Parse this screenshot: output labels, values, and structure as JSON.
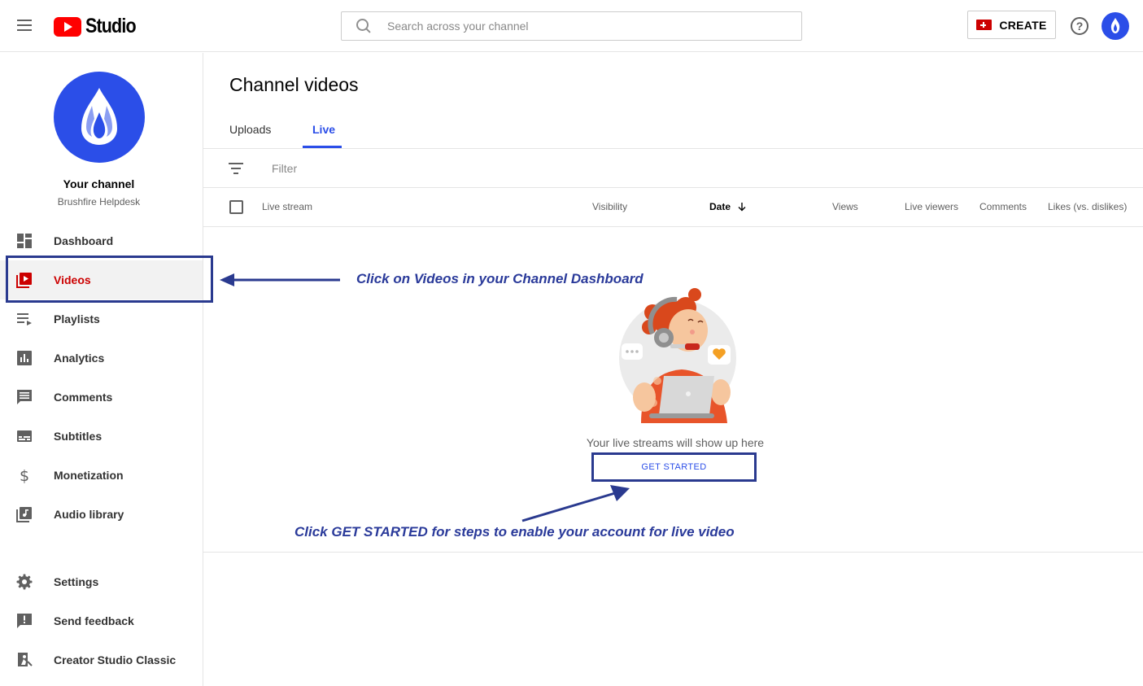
{
  "header": {
    "app_name": "Studio",
    "search_placeholder": "Search across your channel",
    "create_label": "CREATE",
    "help_symbol": "?"
  },
  "sidebar": {
    "channel_title": "Your channel",
    "channel_name": "Brushfire Helpdesk",
    "items": [
      {
        "label": "Dashboard",
        "icon": "dashboard-icon"
      },
      {
        "label": "Videos",
        "icon": "videos-icon",
        "active": true
      },
      {
        "label": "Playlists",
        "icon": "playlists-icon"
      },
      {
        "label": "Analytics",
        "icon": "analytics-icon"
      },
      {
        "label": "Comments",
        "icon": "comments-icon"
      },
      {
        "label": "Subtitles",
        "icon": "subtitles-icon"
      },
      {
        "label": "Monetization",
        "icon": "dollar-icon"
      },
      {
        "label": "Audio library",
        "icon": "audio-library-icon"
      }
    ],
    "footer_items": [
      {
        "label": "Settings",
        "icon": "gear-icon"
      },
      {
        "label": "Send feedback",
        "icon": "feedback-icon"
      },
      {
        "label": "Creator Studio Classic",
        "icon": "classic-studio-icon"
      }
    ]
  },
  "main": {
    "title": "Channel videos",
    "tabs": [
      {
        "label": "Uploads",
        "active": false
      },
      {
        "label": "Live",
        "active": true
      }
    ],
    "filter_placeholder": "Filter",
    "columns": {
      "stream": "Live stream",
      "visibility": "Visibility",
      "date": "Date",
      "views": "Views",
      "live_viewers": "Live viewers",
      "comments": "Comments",
      "likes": "Likes (vs. dislikes)"
    },
    "empty_message": "Your live streams will show up here",
    "get_started_label": "GET STARTED"
  },
  "annotations": {
    "videos_hint": "Click on Videos in your Channel Dashboard",
    "get_started_hint": "Click GET STARTED for steps to enable your account for live video"
  },
  "colors": {
    "accent_blue": "#2b4ee8",
    "youtube_red": "#ff0000",
    "active_red": "#cc0000",
    "annotation_blue": "#2a3a9a"
  }
}
